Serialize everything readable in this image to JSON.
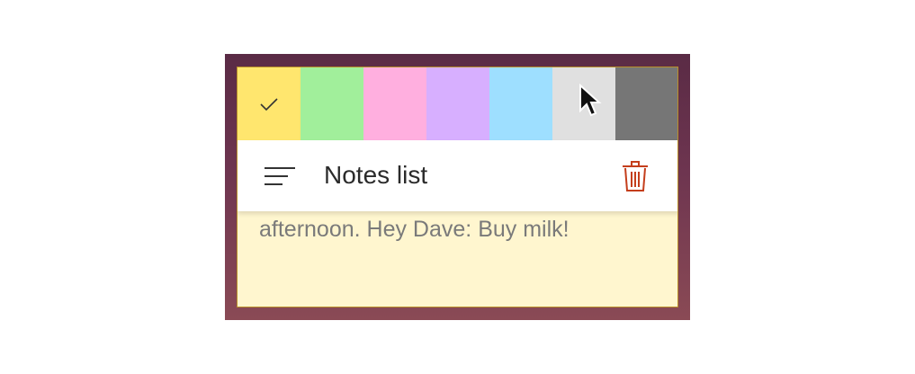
{
  "colors": {
    "swatches": [
      "#ffe66e",
      "#a1ef9b",
      "#ffafdf",
      "#d7afff",
      "#9edfff",
      "#e0e0e0",
      "#767676"
    ],
    "swatch_names": [
      "yellow",
      "green",
      "pink",
      "purple",
      "blue",
      "gray",
      "charcoal"
    ],
    "selected": "yellow",
    "note_background": "#fff6cf",
    "trash_icon": "#c43e1c"
  },
  "menu": {
    "notes_list_label": "Notes list"
  },
  "note": {
    "visible_text": "afternoon. Hey Dave: Buy milk!"
  }
}
